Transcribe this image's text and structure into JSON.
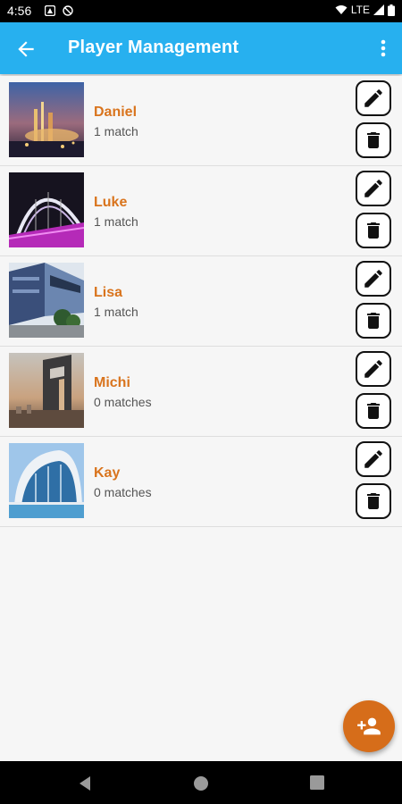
{
  "status_bar": {
    "time": "4:56",
    "network": "LTE"
  },
  "app_bar": {
    "title": "Player Management"
  },
  "players": [
    {
      "name": "Daniel",
      "matches": "1 match"
    },
    {
      "name": "Luke",
      "matches": "1 match"
    },
    {
      "name": "Lisa",
      "matches": "1 match"
    },
    {
      "name": "Michi",
      "matches": "0 matches"
    },
    {
      "name": "Kay",
      "matches": "0 matches"
    }
  ],
  "icons": {
    "back": "arrow-back-icon",
    "menu": "more-vert-icon",
    "edit": "pencil-icon",
    "delete": "trash-icon",
    "fab": "add-person-icon"
  },
  "colors": {
    "app_bar": "#27b0ef",
    "name": "#d9741d",
    "fab": "#d66d1a"
  }
}
